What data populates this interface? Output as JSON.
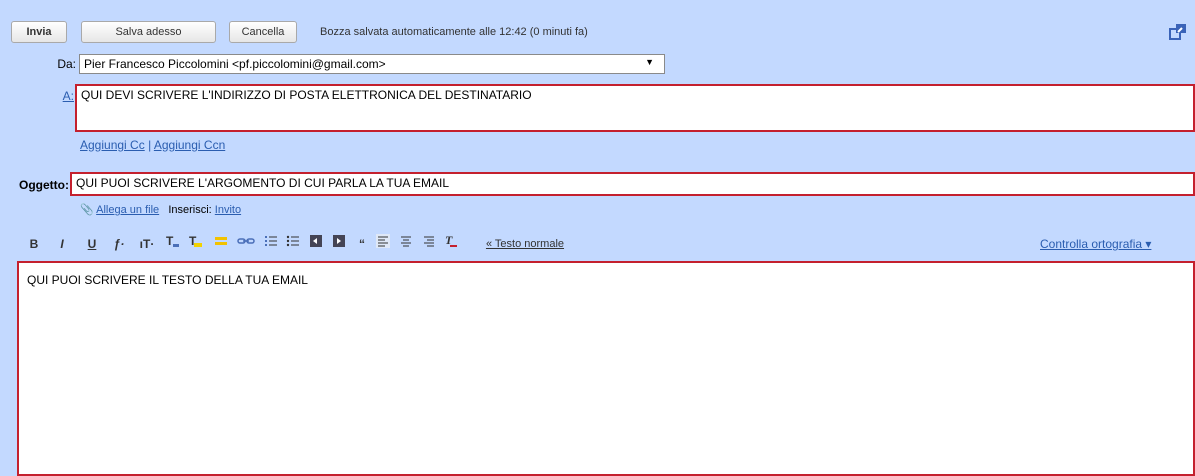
{
  "toolbar": {
    "send_label": "Invia",
    "save_label": "Salva adesso",
    "cancel_label": "Cancella",
    "status": "Bozza salvata automaticamente alle 12:42 (0 minuti fa)"
  },
  "from": {
    "label": "Da:",
    "value": "Pier Francesco Piccolomini <pf.piccolomini@gmail.com>"
  },
  "to": {
    "label": "A:",
    "value": "QUI DEVI SCRIVERE L'INDIRIZZO DI POSTA ELETTRONICA DEL DESTINATARIO"
  },
  "cc_links": {
    "add_cc": "Aggiungi Cc",
    "separator": "|",
    "add_bcc": "Aggiungi Ccn"
  },
  "subject": {
    "label": "Oggetto:",
    "value": "QUI PUOI SCRIVERE L'ARGOMENTO DI CUI PARLA LA TUA EMAIL"
  },
  "attach": {
    "attach_label": "Allega un file",
    "insert_label": "Inserisci:",
    "invite_label": "Invito"
  },
  "format": {
    "bold": "B",
    "italic": "I",
    "underline": "U",
    "font": "ƒ·",
    "size": "ıT·",
    "plain_text_link": "« Testo normale",
    "spellcheck": "Controlla ortografia ▾"
  },
  "body": {
    "value": "QUI PUOI SCRIVERE IL TESTO DELLA TUA EMAIL"
  },
  "colors": {
    "background": "#c3d9ff",
    "highlight_border": "#c4202e",
    "link": "#2a5db0"
  }
}
